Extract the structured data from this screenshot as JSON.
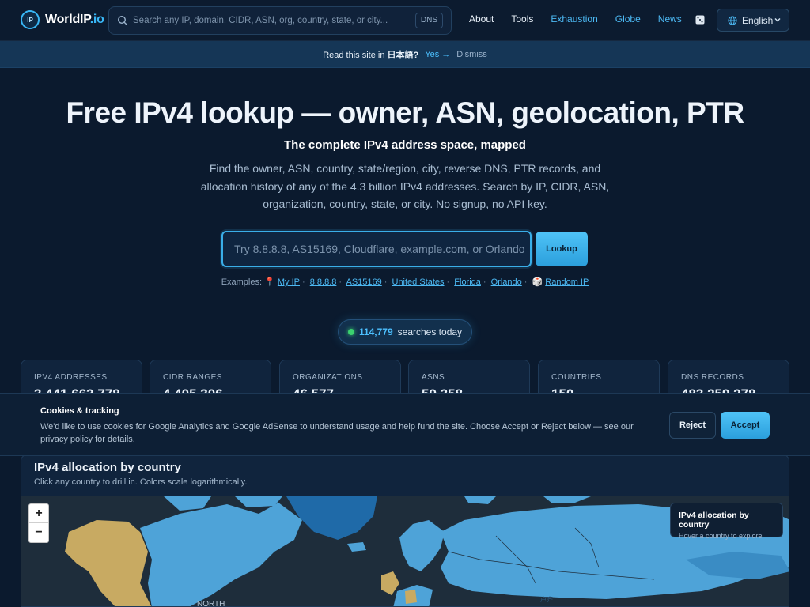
{
  "header": {
    "logo_main": "WorldIP",
    "logo_suffix": ".io",
    "logo_badge": "IP",
    "search_placeholder": "Search any IP, domain, CIDR, ASN, org, country, state, or city...",
    "dns_chip": "DNS",
    "nav": [
      {
        "label": "About",
        "color": "white"
      },
      {
        "label": "Tools",
        "color": "white"
      },
      {
        "label": "Exhaustion",
        "color": "blue"
      },
      {
        "label": "Globe",
        "color": "blue"
      },
      {
        "label": "News",
        "color": "blue"
      }
    ],
    "language": "English"
  },
  "notice": {
    "text": "Read this site in",
    "language_name": "日本語?",
    "yes_label": "Yes →",
    "dismiss_label": "Dismiss"
  },
  "hero": {
    "title": "Free IPv4 lookup — owner, ASN, geolocation, PTR",
    "subtitle": "The complete IPv4 address space, mapped",
    "description": "Find the owner, ASN, country, state/region, city, reverse DNS, PTR records, and allocation history of any of the 4.3 billion IPv4 addresses. Search by IP, CIDR, ASN, organization, country, state, or city. No signup, no API key.",
    "lookup_placeholder": "Try 8.8.8.8, AS15169, Cloudflare, example.com, or Orlando",
    "lookup_button": "Lookup",
    "examples_label": "Examples:",
    "examples": [
      "My IP",
      "8.8.8.8",
      "AS15169",
      "United States",
      "Florida",
      "Orlando",
      "Random IP"
    ]
  },
  "counter": {
    "value": "114,779",
    "label": "searches today"
  },
  "stats": [
    {
      "label": "IPV4 ADDRESSES",
      "value": "3,441,663,778"
    },
    {
      "label": "CIDR RANGES",
      "value": "4,405,306"
    },
    {
      "label": "ORGANIZATIONS",
      "value": "46,577"
    },
    {
      "label": "ASNS",
      "value": "59,358"
    },
    {
      "label": "COUNTRIES",
      "value": "150"
    },
    {
      "label": "DNS RECORDS",
      "value": "483,259,278"
    }
  ],
  "cookie": {
    "title": "Cookies & tracking",
    "text": "We'd like to use cookies for Google Analytics and Google AdSense to understand usage and help fund the site. Choose Accept or Reject below — see our privacy policy for details.",
    "reject_label": "Reject",
    "accept_label": "Accept"
  },
  "map": {
    "title": "IPv4 allocation by country",
    "subtitle": "Click any country to drill in. Colors scale logarithmically.",
    "zoom_in": "+",
    "zoom_out": "−",
    "legend_title": "IPv4 allocation by country",
    "legend_sub": "Hover a country to explore",
    "label_north": "NORTH"
  },
  "colors": {
    "accent": "#38b6f5",
    "background": "#0b1a2e",
    "map_land_blue": "#4ea3d8",
    "map_land_gold": "#c8aa62"
  }
}
